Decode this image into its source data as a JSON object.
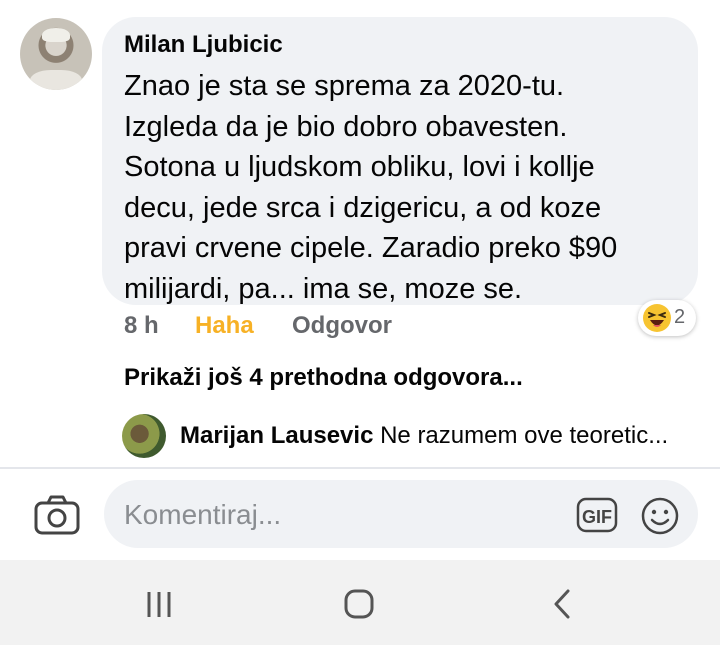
{
  "comment": {
    "author": "Milan Ljubicic",
    "text_lines": [
      "Znao je sta se sprema za 2020-tu.",
      "Izgleda da je bio dobro obavesten.",
      "Sotona u ljudskom obliku, lovi i kollje",
      "decu, jede srca i dzigericu, a od koze",
      "pravi crvene cipele. Zaradio preko $90",
      "milijardi, pa... ima se, moze se."
    ],
    "time": "8 h",
    "reaction_label": "Haha",
    "reply_label": "Odgovor",
    "reaction_icon": "haha-emoji-icon",
    "reaction_count": "2"
  },
  "more_replies": "Prikaži još 4 prethodna odgovora...",
  "reply": {
    "author": "Marijan Lausevic",
    "preview": "Ne razumem ove teoretic..."
  },
  "composer": {
    "placeholder": "Komentiraj...",
    "camera_icon": "camera-icon",
    "gif_icon": "gif-icon",
    "emoji_icon": "smiley-icon"
  },
  "navbar": {
    "recents_icon": "recents-icon",
    "home_icon": "home-icon",
    "back_icon": "back-icon"
  },
  "colors": {
    "bubble": "#f0f2f5",
    "haha_accent": "#f7b125",
    "secondary_text": "#65676b"
  }
}
